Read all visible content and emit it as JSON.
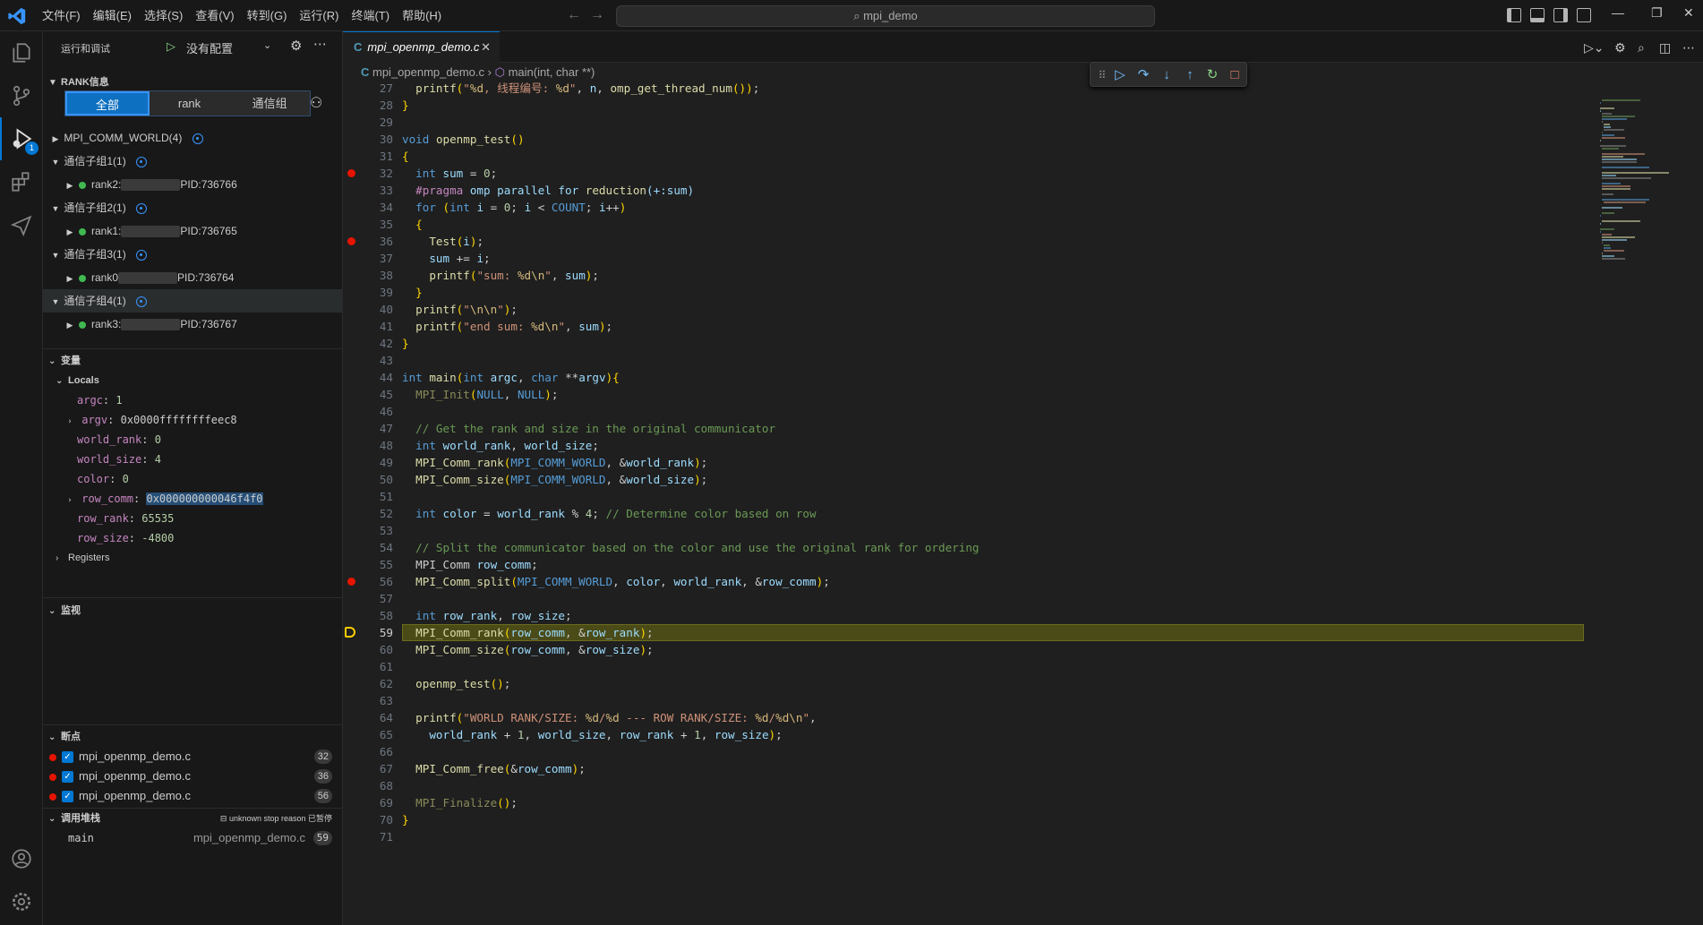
{
  "titlebar": {
    "menus": [
      "文件(F)",
      "编辑(E)",
      "选择(S)",
      "查看(V)",
      "转到(G)",
      "运行(R)",
      "终端(T)",
      "帮助(H)"
    ],
    "search_text": "mpi_demo"
  },
  "activity": {
    "debug_badge": "1"
  },
  "sidebar": {
    "header_title": "运行和调试",
    "config_label": "没有配置",
    "rank_section_title": "RANK信息",
    "segments": [
      "全部",
      "rank",
      "通信组"
    ],
    "world": "MPI_COMM_WORLD(4)",
    "groups": [
      {
        "label": "通信子组1(1)",
        "rank_label": "rank2:",
        "pid": "PID:736766"
      },
      {
        "label": "通信子组2(1)",
        "rank_label": "rank1:",
        "pid": "PID:736765"
      },
      {
        "label": "通信子组3(1)",
        "rank_label": "rank0",
        "pid": "PID:736764"
      },
      {
        "label": "通信子组4(1)",
        "rank_label": "rank3:",
        "pid": "PID:736767"
      }
    ],
    "variables_title": "变量",
    "locals_title": "Locals",
    "variables": [
      {
        "name": "argc",
        "value": "1"
      },
      {
        "name": "argv",
        "value": "0x0000ffffffffeec8"
      },
      {
        "name": "world_rank",
        "value": "0"
      },
      {
        "name": "world_size",
        "value": "4"
      },
      {
        "name": "color",
        "value": "0"
      },
      {
        "name": "row_comm",
        "value": "0x000000000046f4f0"
      },
      {
        "name": "row_rank",
        "value": "65535"
      },
      {
        "name": "row_size",
        "value": "-4800"
      }
    ],
    "registers_title": "Registers",
    "watch_title": "监视",
    "breakpoints_title": "断点",
    "breakpoints": [
      {
        "file": "mpi_openmp_demo.c",
        "line": "32"
      },
      {
        "file": "mpi_openmp_demo.c",
        "line": "36"
      },
      {
        "file": "mpi_openmp_demo.c",
        "line": "56"
      }
    ],
    "callstack_title": "调用堆栈",
    "callstack_status": "unknown stop reason 已暂停",
    "callstack_frame": {
      "name": "main",
      "file": "mpi_openmp_demo.c",
      "line": "59"
    }
  },
  "editor": {
    "tab_label": "mpi_openmp_demo.c",
    "breadcrumb_file": "mpi_openmp_demo.c",
    "breadcrumb_symbol": "main(int, char **)",
    "line_numbers": [
      "27",
      "28",
      "29",
      "30",
      "31",
      "32",
      "33",
      "34",
      "35",
      "36",
      "37",
      "38",
      "39",
      "40",
      "41",
      "42",
      "43",
      "44",
      "45",
      "46",
      "47",
      "48",
      "49",
      "50",
      "51",
      "52",
      "53",
      "54",
      "55",
      "56",
      "57",
      "58",
      "59",
      "60",
      "61",
      "62",
      "63",
      "64",
      "65",
      "66",
      "67",
      "68",
      "69",
      "70",
      "71"
    ],
    "code": [
      "  printf(\"%d, 线程编号: %d\", n, omp_get_thread_num());",
      "}",
      "",
      "void openmp_test()",
      "{",
      "  int sum = 0;",
      "  #pragma omp parallel for reduction(+:sum)",
      "  for (int i = 0; i < COUNT; i++)",
      "  {",
      "    Test(i);",
      "    sum += i;",
      "    printf(\"sum: %d\\n\", sum);",
      "  }",
      "  printf(\"\\n\\n\");",
      "  printf(\"end sum: %d\\n\", sum);",
      "}",
      "",
      "int main(int argc, char **argv){",
      "  MPI_Init(NULL, NULL);",
      "",
      "  // Get the rank and size in the original communicator",
      "  int world_rank, world_size;",
      "  MPI_Comm_rank(MPI_COMM_WORLD, &world_rank);",
      "  MPI_Comm_size(MPI_COMM_WORLD, &world_size);",
      "",
      "  int color = world_rank % 4; // Determine color based on row",
      "",
      "  // Split the communicator based on the color and use the original rank for ordering",
      "  MPI_Comm row_comm;",
      "  MPI_Comm_split(MPI_COMM_WORLD, color, world_rank, &row_comm);",
      "",
      "  int row_rank, row_size;",
      "  MPI_Comm_rank(row_comm, &row_rank);",
      "  MPI_Comm_size(row_comm, &row_size);",
      "",
      "  openmp_test();",
      "",
      "  printf(\"WORLD RANK/SIZE: %d/%d --- ROW RANK/SIZE: %d/%d\\n\",",
      "    world_rank + 1, world_size, row_rank + 1, row_size);",
      "",
      "  MPI_Comm_free(&row_comm);",
      "",
      "  MPI_Finalize();",
      "}",
      ""
    ],
    "current_line": "59",
    "breakpoint_lines": [
      "32",
      "36",
      "56"
    ]
  }
}
